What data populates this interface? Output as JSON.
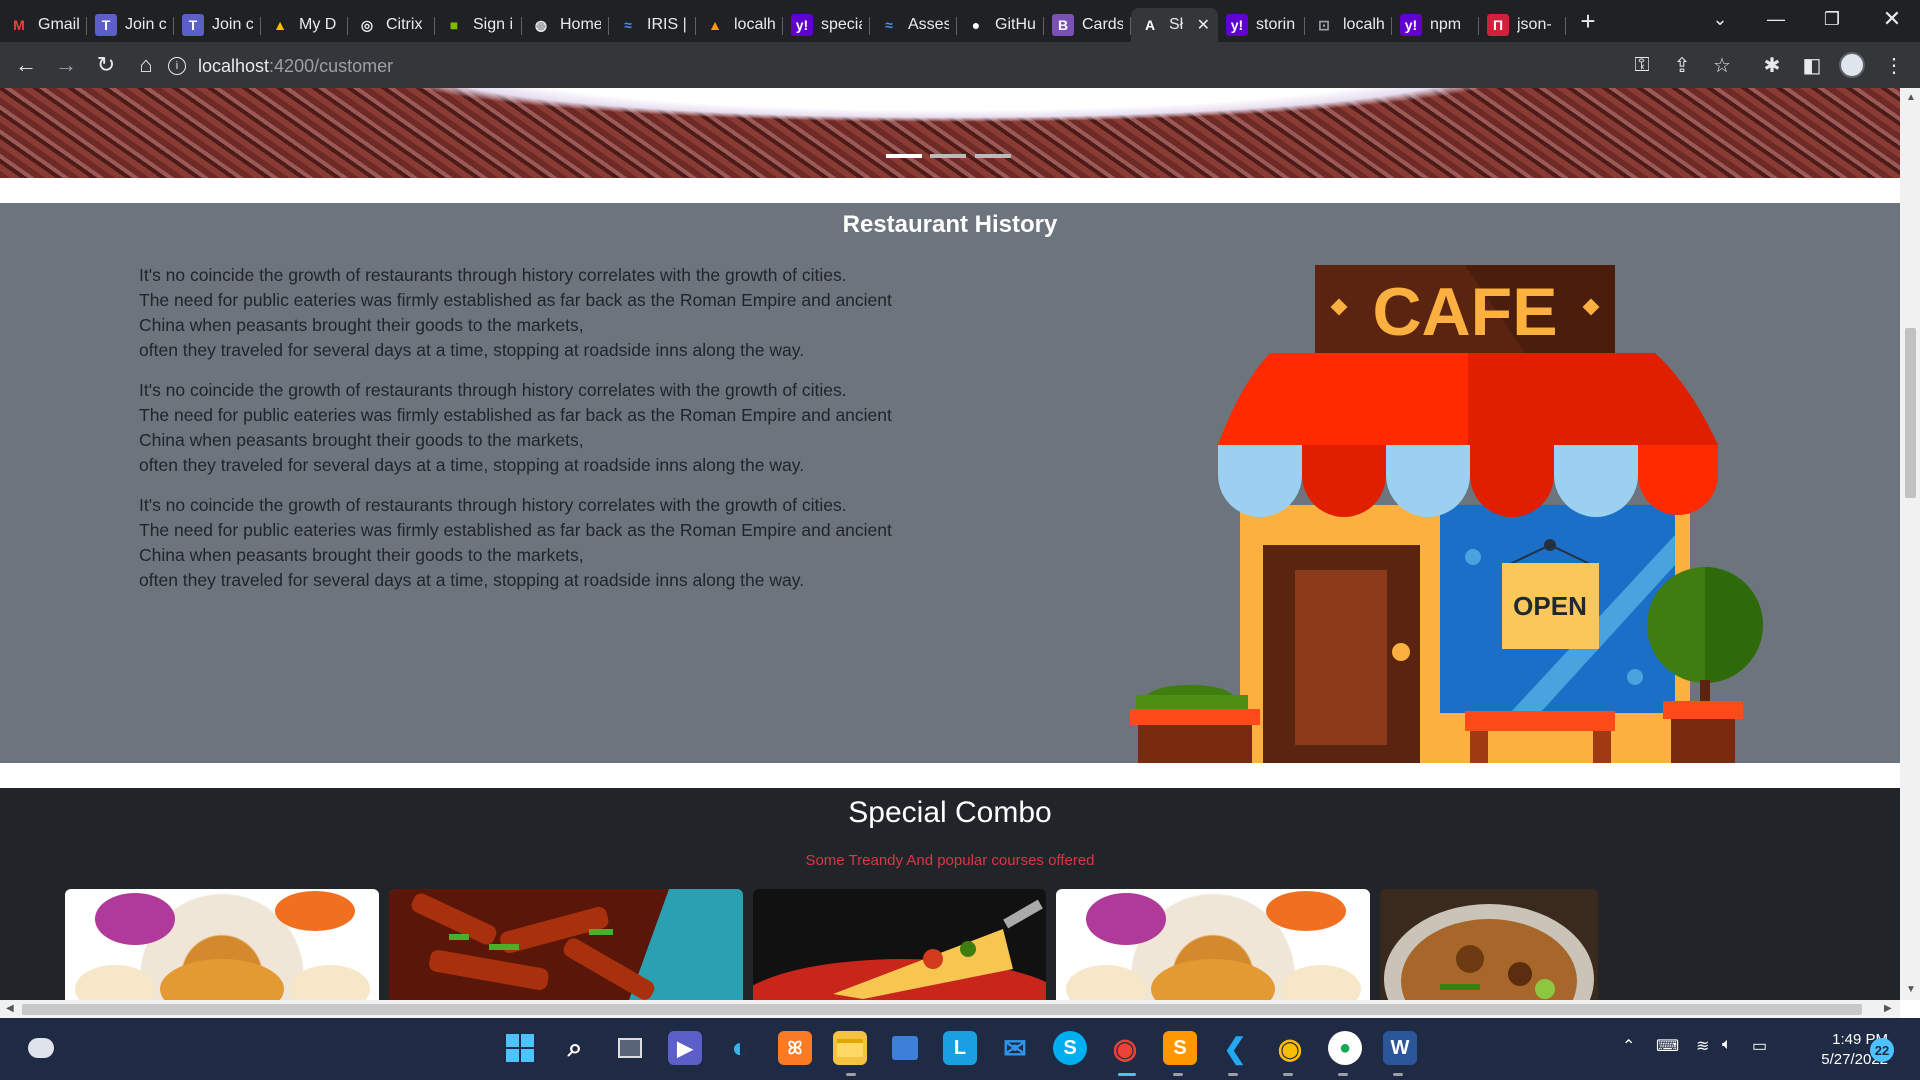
{
  "tabs": [
    {
      "title": "Gmail",
      "icon": "gmail-icon",
      "glyph": "M",
      "color": "#ea4335",
      "bg": "transparent"
    },
    {
      "title": "Join c",
      "icon": "teams-icon",
      "glyph": "T",
      "color": "#fff",
      "bg": "#5b5fc7"
    },
    {
      "title": "Join c",
      "icon": "teams-icon",
      "glyph": "T",
      "color": "#fff",
      "bg": "#5b5fc7"
    },
    {
      "title": "My D",
      "icon": "google-drive-icon",
      "glyph": "▲",
      "color": "#fbbc04",
      "bg": "transparent"
    },
    {
      "title": "Citrix",
      "icon": "citrix-icon",
      "glyph": "◎",
      "color": "#e8eaed",
      "bg": "transparent"
    },
    {
      "title": "Sign i",
      "icon": "microsoft-icon",
      "glyph": "■",
      "color": "#7fba00",
      "bg": "transparent"
    },
    {
      "title": "Home",
      "icon": "globe-icon",
      "glyph": "◍",
      "color": "#e8eaed",
      "bg": "transparent"
    },
    {
      "title": "IRIS |",
      "icon": "iris-icon",
      "glyph": "≈",
      "color": "#4c8bf5",
      "bg": "transparent"
    },
    {
      "title": "localh",
      "icon": "angular-icon",
      "glyph": "▲",
      "color": "#f39c12",
      "bg": "transparent"
    },
    {
      "title": "specia",
      "icon": "yahoo-icon",
      "glyph": "y!",
      "color": "#fff",
      "bg": "#6001d2"
    },
    {
      "title": "Asses",
      "icon": "iris-icon",
      "glyph": "≈",
      "color": "#4c8bf5",
      "bg": "transparent"
    },
    {
      "title": "GitHu",
      "icon": "github-icon",
      "glyph": "●",
      "color": "#fff",
      "bg": "transparent"
    },
    {
      "title": "Cards",
      "icon": "bootstrap-icon",
      "glyph": "B",
      "color": "#fff",
      "bg": "#7952b3"
    },
    {
      "title": "Sł",
      "icon": "angular-icon",
      "glyph": "A",
      "color": "#fff",
      "bg": "transparent",
      "active": true
    },
    {
      "title": "storin",
      "icon": "yahoo-icon",
      "glyph": "y!",
      "color": "#fff",
      "bg": "#6001d2"
    },
    {
      "title": "localh",
      "icon": "page-icon",
      "glyph": "⊡",
      "color": "#9aa0a6",
      "bg": "transparent"
    },
    {
      "title": "npm",
      "icon": "yahoo-icon",
      "glyph": "y!",
      "color": "#fff",
      "bg": "#6001d2"
    },
    {
      "title": "json-",
      "icon": "json-icon",
      "glyph": "П",
      "color": "#fff",
      "bg": "#d21f3c"
    }
  ],
  "address": {
    "host": "localhost",
    "path": ":4200/customer"
  },
  "history": {
    "title": "Restaurant History",
    "paragraphs": [
      [
        "It's no coincide the growth of restaurants through history correlates with the growth of cities.",
        "The need for public eateries was firmly established as far back as the Roman Empire and ancient",
        "China when peasants brought their goods to the markets,",
        "often they traveled for several days at a time, stopping at roadside inns along the way."
      ],
      [
        "It's no coincide the growth of restaurants through history correlates with the growth of cities.",
        "The need for public eateries was firmly established as far back as the Roman Empire and ancient",
        "China when peasants brought their goods to the markets,",
        "often they traveled for several days at a time, stopping at roadside inns along the way."
      ],
      [
        "It's no coincide the growth of restaurants through history correlates with the growth of cities.",
        "The need for public eateries was firmly established as far back as the Roman Empire and ancient",
        "China when peasants brought their goods to the markets,",
        "often they traveled for several days at a time, stopping at roadside inns along the way."
      ]
    ],
    "cafe_sign": "CAFE",
    "open_sign": "OPEN"
  },
  "combo": {
    "title": "Special Combo",
    "subtitle": "Some Treandy And popular courses offered",
    "foods": [
      "momos-image",
      "chilli-chicken-image",
      "pizza-image",
      "momos-image",
      "biryani-image"
    ]
  },
  "taskbar": {
    "time": "1:49 PM",
    "date": "5/27/2022",
    "notifications": "22"
  }
}
